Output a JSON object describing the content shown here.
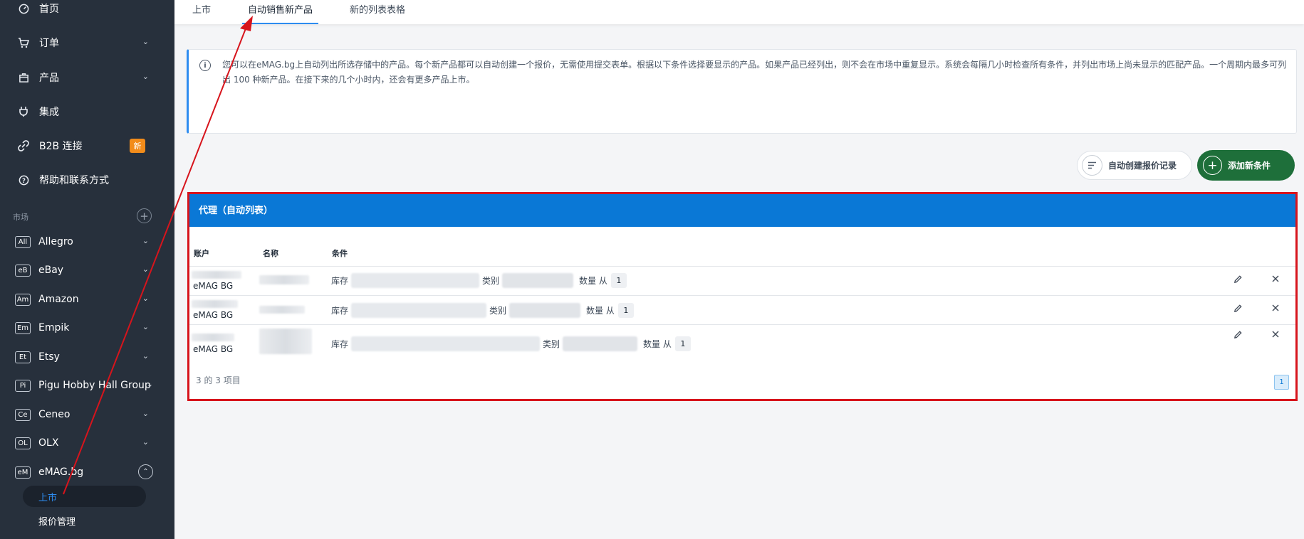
{
  "sidebar": {
    "nav": [
      {
        "label": "首页",
        "icon": "dashboard-icon"
      },
      {
        "label": "订单",
        "icon": "cart-icon"
      },
      {
        "label": "产品",
        "icon": "box-icon"
      },
      {
        "label": "集成",
        "icon": "plug-icon"
      },
      {
        "label": "B2B 连接",
        "icon": "link-icon",
        "badge": "新"
      },
      {
        "label": "帮助和联系方式",
        "icon": "help-icon"
      }
    ],
    "section_label": "市场",
    "section_add": "+",
    "markets": [
      {
        "abbr": "All",
        "label": "Allegro"
      },
      {
        "abbr": "eB",
        "label": "eBay"
      },
      {
        "abbr": "Am",
        "label": "Amazon"
      },
      {
        "abbr": "Em",
        "label": "Empik"
      },
      {
        "abbr": "Et",
        "label": "Etsy"
      },
      {
        "abbr": "Pi",
        "label": "Pigu Hobby Hall Group"
      },
      {
        "abbr": "Ce",
        "label": "Ceneo"
      },
      {
        "abbr": "OL",
        "label": "OLX"
      },
      {
        "abbr": "eM",
        "label": "eMAG.bg"
      }
    ],
    "sub_items": [
      {
        "label": "上市",
        "active": true
      },
      {
        "label": "报价管理",
        "active": false
      }
    ]
  },
  "tabs": [
    {
      "label": "上市",
      "active": false
    },
    {
      "label": "自动销售新产品",
      "active": true
    },
    {
      "label": "新的列表表格",
      "active": false
    }
  ],
  "info": {
    "icon": "info-icon",
    "text": "您可以在eMAG.bg上自动列出所选存储中的产品。每个新产品都可以自动创建一个报价，无需使用提交表单。根据以下条件选择要显示的产品。如果产品已经列出，则不会在市场中重复显示。系统会每隔几小时检查所有条件，并列出市场上尚未显示的匹配产品。一个周期内最多可列出 100 种新产品。在接下来的几个小时内，还会有更多产品上市。"
  },
  "actions": {
    "log_label": "自动创建报价记录",
    "add_label": "添加新条件"
  },
  "panel": {
    "title": "代理（自动列表）",
    "columns": {
      "account": "账户",
      "name": "名称",
      "conditions": "条件"
    },
    "rows": [
      {
        "account": "eMAG BG",
        "stock_label": "库存",
        "category_label": "类别",
        "qty_label": "数量 从",
        "qty_value": "1"
      },
      {
        "account": "eMAG BG",
        "stock_label": "库存",
        "category_label": "类别",
        "qty_label": "数量 从",
        "qty_value": "1"
      },
      {
        "account": "eMAG BG",
        "stock_label": "库存",
        "category_label": "类别",
        "qty_label": "数量 从",
        "qty_value": "1"
      }
    ],
    "count_text": "3 的 3 项目",
    "page": "1"
  },
  "colors": {
    "sidebar_bg": "#27303c",
    "accent_blue": "#0a78d6",
    "add_green": "#1e6f3a",
    "highlight_red": "#d7141c",
    "badge_orange": "#f28c1b"
  }
}
